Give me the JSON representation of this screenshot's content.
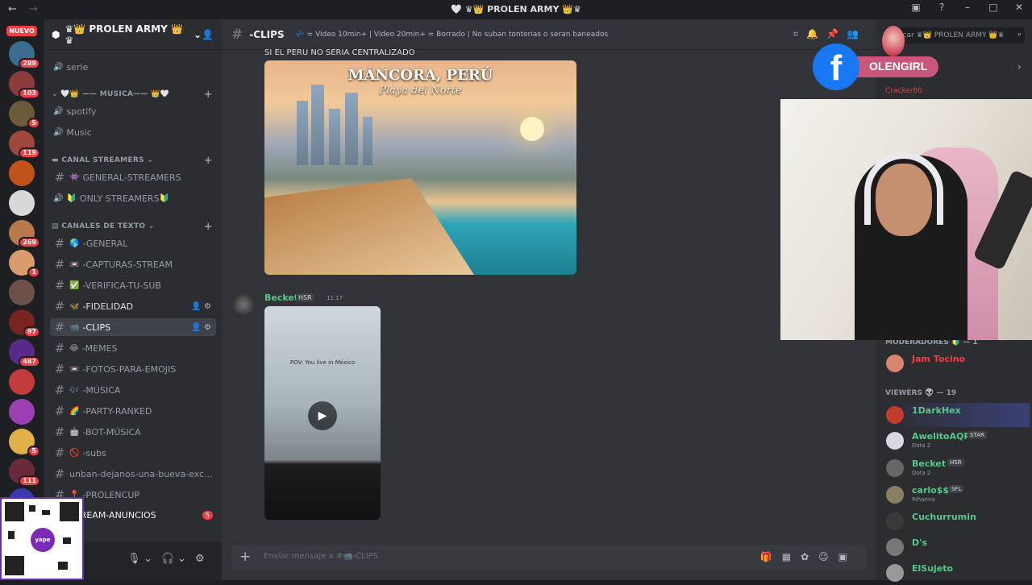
{
  "titlebar": {
    "title": "🤍 ♛👑 PROLEN ARMY 👑♛"
  },
  "guilds": {
    "nuevo_label": "NUEVO",
    "badges": [
      "289",
      "103",
      "5",
      "119",
      "",
      "",
      "269",
      "1",
      "",
      "97",
      "487",
      "",
      "",
      "5",
      "111",
      ""
    ]
  },
  "server": {
    "name": "♛👑 PROLEN ARMY 👑♛"
  },
  "categories": {
    "musica": "—— MUSICA——",
    "canal_streamers": "CANAL STREAMERS",
    "canales_texto": "CANALES DE TEXTO"
  },
  "channels": {
    "serie": "serie",
    "spotify": "spotify",
    "music": "Music",
    "general_streamers": "GENERAL-STREAMERS",
    "only_streamers": "ONLY STREAMERS",
    "general": "-GENERAL",
    "capturas": "-CAPTURAS-STREAM",
    "verifica": "-VERIFICA-TU-SUB",
    "fidelidad": "-FIDELIDAD",
    "clips": "-CLIPS",
    "memes": "-MEMES",
    "fotos": "-FOTOS-PARA-EMOJIS",
    "musica": "-MÚSICA",
    "party": "-PARTY-RANKED",
    "bot": "-BOT-MÚSICA",
    "subs": "-subs",
    "unban": "unban-dejanos-una-bueva-exc...",
    "prolencup": "-PROLENCUP",
    "anuncios": "STREAM-ANUNCIOS",
    "anuncios_count": "5"
  },
  "header": {
    "channel": "-CLIPS",
    "topic": "💤 = Video 10min+ | Video 20min+ = Borrado | No suban tonterias o seran baneados"
  },
  "chat": {
    "prev_line": "SI EL PERU NO SERIA CENTRALIZADO",
    "image_title": "MÁNCORA, PERÚ",
    "image_subtitle": "Playa del Norte",
    "author": "Becket",
    "author_tag": "HSR",
    "time": "11:17",
    "video_caption": "POV: You live in México",
    "composer_placeholder": "Enviar mensaje a #📹-CLIPS"
  },
  "members": {
    "search_placeholder": "Buscar ♛👑 PROLEN ARMY 👑♛",
    "top_member": "Cracker80",
    "moderadores_label": "MODERADORES",
    "moderator": "Jam Tocino",
    "viewers_label": "VIEWERS",
    "viewers_count": "19",
    "list": [
      {
        "name": "1DarkHex",
        "sub": "",
        "tag": "",
        "color": "#57c78a"
      },
      {
        "name": "AwelitoAQP",
        "sub": "Dota 2",
        "tag": "STAR",
        "color": "#57c78a"
      },
      {
        "name": "Becket",
        "sub": "Dota 2",
        "tag": "HSR",
        "color": "#57c78a"
      },
      {
        "name": "carlo$$",
        "sub": "Rihanna",
        "tag": "SFL",
        "color": "#57c78a"
      },
      {
        "name": "Cuchurrumin",
        "sub": "",
        "tag": "",
        "color": "#57c78a"
      },
      {
        "name": "D's",
        "sub": "",
        "tag": "",
        "color": "#57c78a"
      },
      {
        "name": "ElSujeto",
        "sub": "",
        "tag": "",
        "color": "#57c78a"
      }
    ]
  },
  "overlay": {
    "facebook_name": "OLENGIRL",
    "fb_letter": "f"
  },
  "qr": {
    "label": "yape"
  },
  "colors": {
    "accent": "#5865f2",
    "online_green": "#57c78a",
    "mod_red": "#f23f43"
  }
}
